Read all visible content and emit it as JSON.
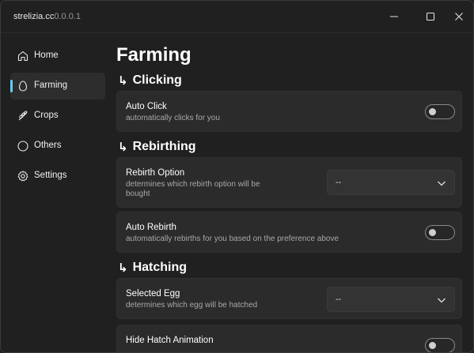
{
  "window": {
    "title": "strelizia.cc",
    "version": "0.0.0.1"
  },
  "titlebar_icons": [
    "minimize-icon",
    "maximize-icon",
    "close-icon"
  ],
  "sidebar": {
    "items": [
      {
        "label": "Home",
        "icon": "home-icon",
        "active": false
      },
      {
        "label": "Farming",
        "icon": "egg-icon",
        "active": true
      },
      {
        "label": "Crops",
        "icon": "crop-icon",
        "active": false
      },
      {
        "label": "Others",
        "icon": "circle-icon",
        "active": false
      },
      {
        "label": "Settings",
        "icon": "gear-icon",
        "active": false
      }
    ]
  },
  "main": {
    "page_title": "Farming",
    "arrow_glyph": "↳",
    "sections": [
      {
        "heading": "Clicking",
        "settings": [
          {
            "title": "Auto Click",
            "description": "automatically clicks for you",
            "control": "toggle",
            "value": "off"
          }
        ]
      },
      {
        "heading": "Rebirthing",
        "settings": [
          {
            "title": "Rebirth Option",
            "description_line1": "determines which rebirth option will be",
            "description_line2": "bought",
            "control": "dropdown",
            "value": "--"
          },
          {
            "title": "Auto Rebirth",
            "description": "automatically rebirths for you based on the preference above",
            "control": "toggle",
            "value": "off"
          }
        ]
      },
      {
        "heading": "Hatching",
        "settings": [
          {
            "title": "Selected Egg",
            "description": "determines which egg will be hatched",
            "control": "dropdown",
            "value": "--"
          },
          {
            "title": "Hide Hatch Animation",
            "control": "toggle",
            "value": "off"
          }
        ]
      }
    ]
  },
  "colors": {
    "background": "#202020",
    "card": "#2b2b2b",
    "accent": "#60cdff"
  }
}
